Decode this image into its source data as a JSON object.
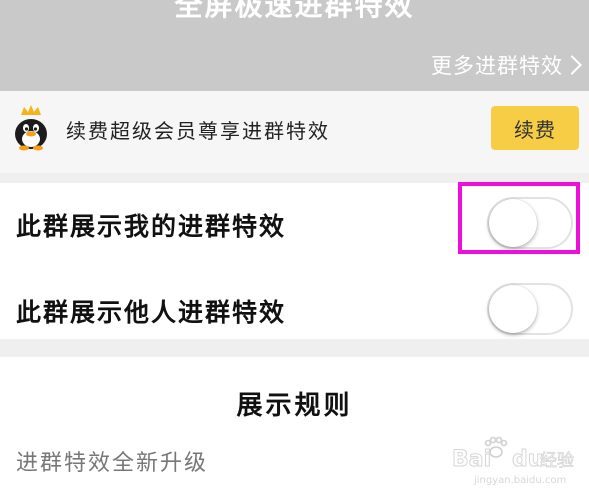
{
  "header": {
    "title": "全屏极速进群特效",
    "more_link": "更多进群特效"
  },
  "vip": {
    "text": "续费超级会员尊享进群特效",
    "button_label": "续费",
    "button_color": "#f6cd44"
  },
  "toggles": [
    {
      "label": "此群展示我的进群特效",
      "enabled": false
    },
    {
      "label": "此群展示他人进群特效",
      "enabled": false
    }
  ],
  "rules": {
    "title": "展示规则",
    "subtitle": "进群特效全新升级"
  },
  "watermark": {
    "text": "Baidu经验",
    "url_text": "jingyan.baidu.com"
  },
  "colors": {
    "banner_bg": "#c9c9c9",
    "highlight": "#ee10d8"
  }
}
